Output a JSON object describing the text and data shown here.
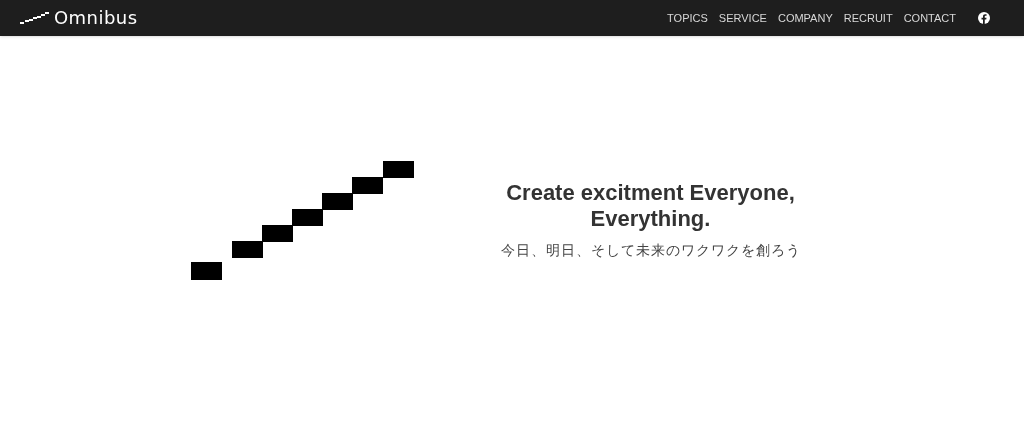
{
  "header": {
    "logo": "Omnibus",
    "nav": [
      {
        "label": "TOPICS"
      },
      {
        "label": "SERVICE"
      },
      {
        "label": "COMPANY"
      },
      {
        "label": "RECRUIT"
      },
      {
        "label": "CONTACT"
      }
    ]
  },
  "hero": {
    "headline": [
      "Create excitment Everyone,",
      "Everything."
    ],
    "tagline": "今日、明日、そして未来のワクワクを創ろう"
  }
}
